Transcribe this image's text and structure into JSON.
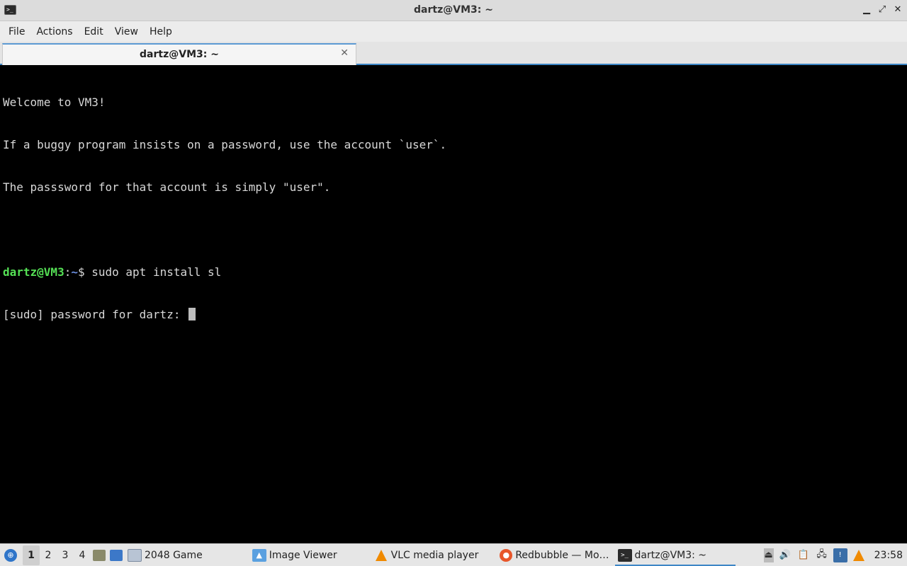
{
  "window": {
    "title": "dartz@VM3: ~",
    "minimize": "▁",
    "maximize": "⤢",
    "close": "✕"
  },
  "menu": [
    "File",
    "Actions",
    "Edit",
    "View",
    "Help"
  ],
  "tab": {
    "label": "dartz@VM3: ~",
    "close": "✕"
  },
  "terminal": {
    "lines": [
      "Welcome to VM3!",
      "If a buggy program insists on a password, use the account `user`.",
      "The passsword for that account is simply \"user\".",
      ""
    ],
    "prompt_user": "dartz@VM3",
    "prompt_sep": ":",
    "prompt_path": "~",
    "prompt_symbol": "$ ",
    "command": "sudo apt install sl",
    "password_prompt": "[sudo] password for dartz: "
  },
  "taskbar": {
    "desktops": [
      "1",
      "2",
      "3",
      "4"
    ],
    "active_desktop": "1",
    "tasks": [
      {
        "label": "2048 Game",
        "icon": "window-icon"
      },
      {
        "label": "Image Viewer",
        "icon": "image-viewer-icon"
      },
      {
        "label": "VLC media player",
        "icon": "vlc-icon"
      },
      {
        "label": "Redbubble — Mo…",
        "icon": "firefox-icon"
      },
      {
        "label": "dartz@VM3: ~",
        "icon": "terminal-icon"
      }
    ],
    "clock": "23:58"
  },
  "colors": {
    "prompt_user": "#55e055",
    "prompt_path": "#6c8fe0",
    "accent": "#3d86c6"
  }
}
